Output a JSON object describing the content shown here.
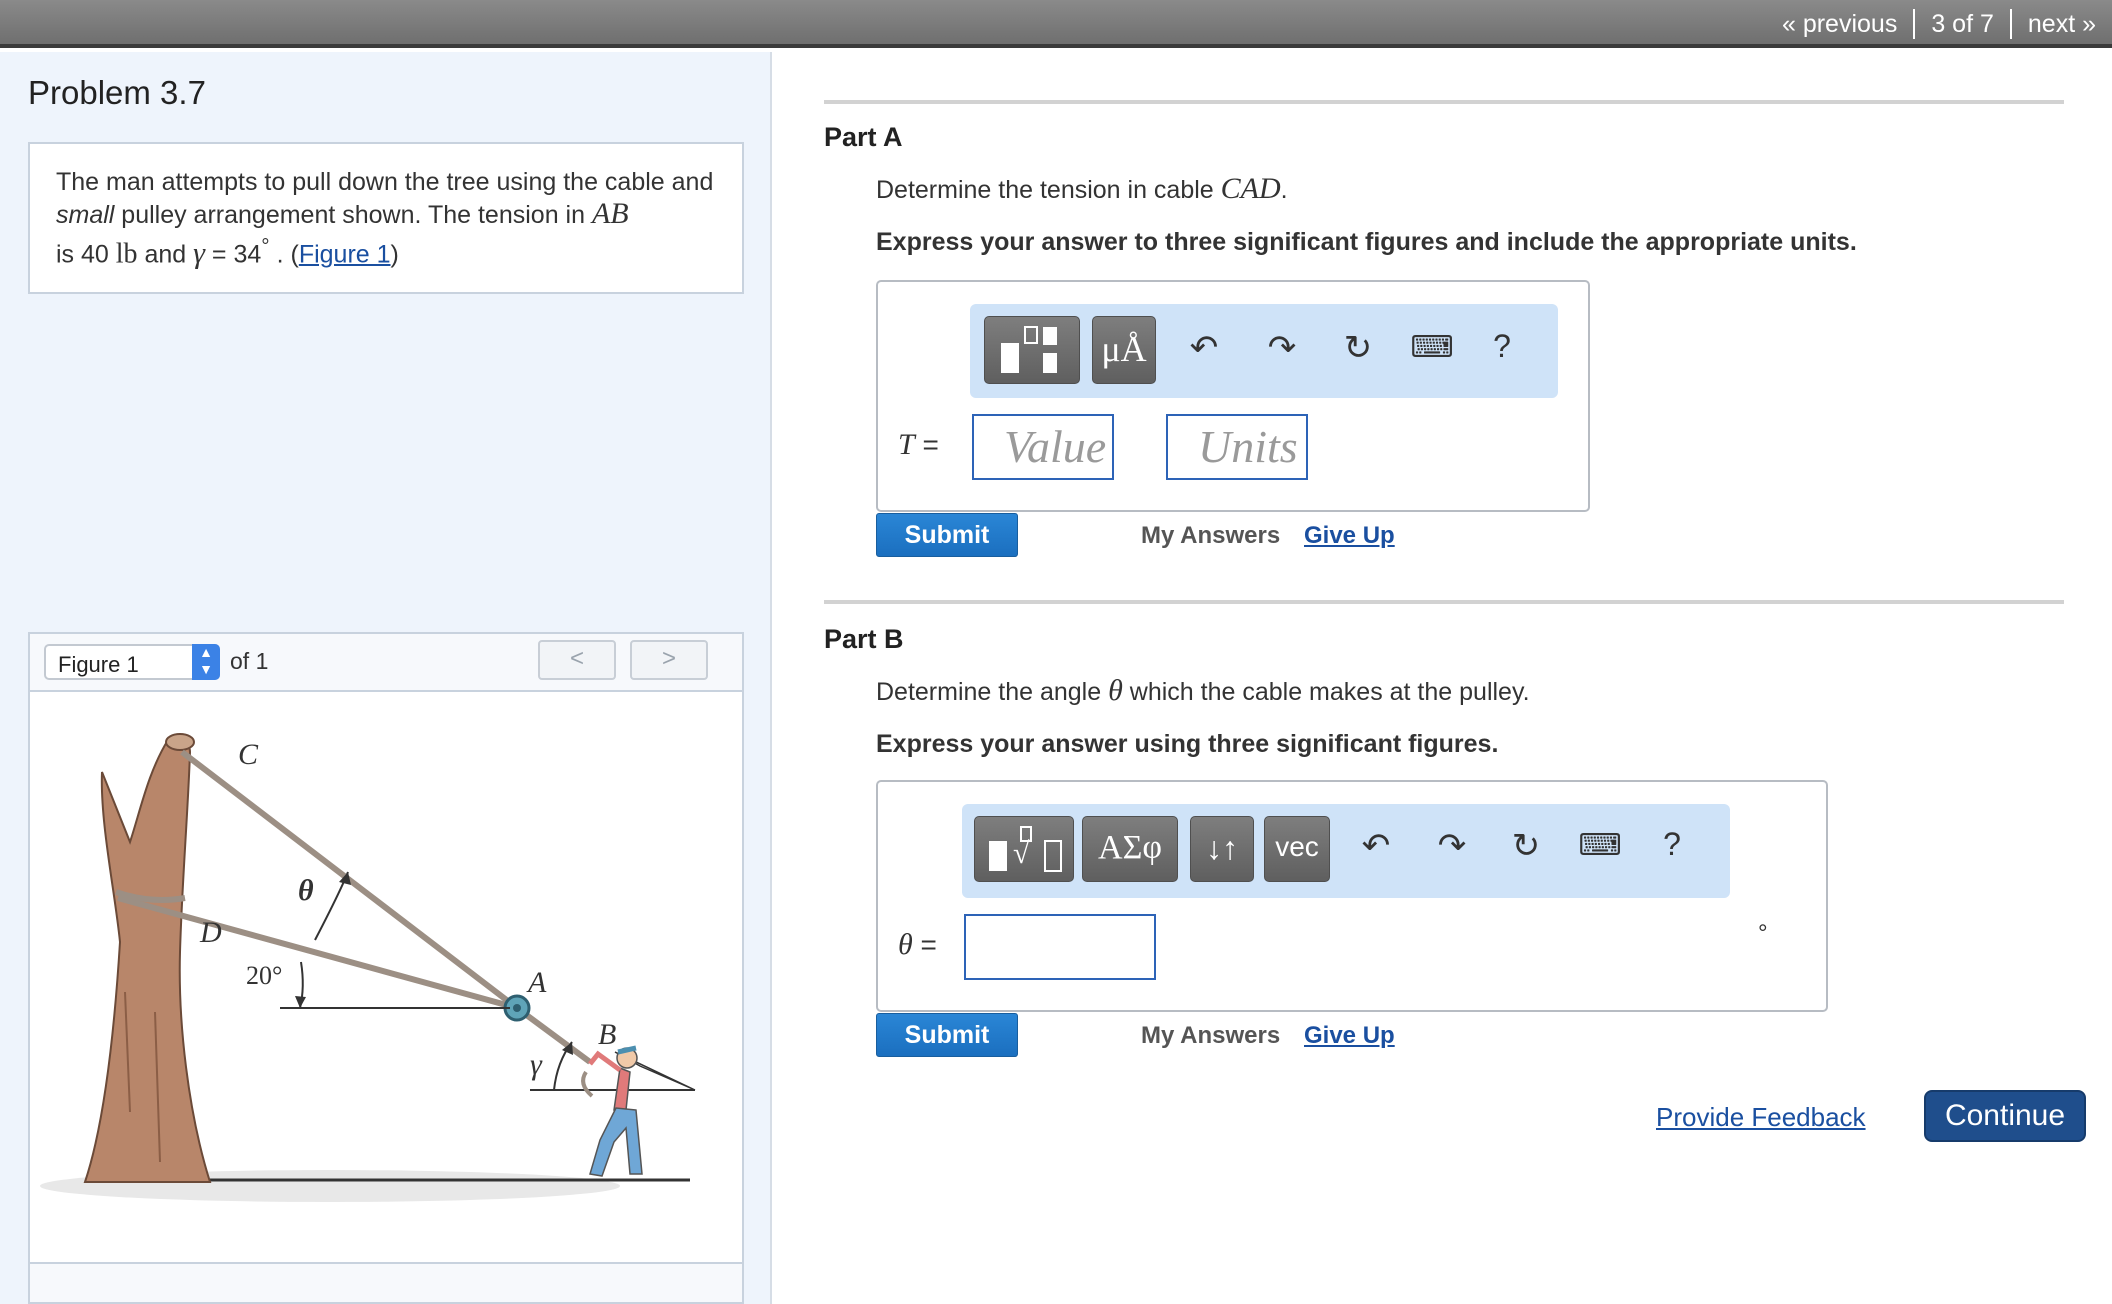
{
  "nav": {
    "previous": "« previous",
    "position": "3 of 7",
    "next": "next »"
  },
  "problem": {
    "title": "Problem 3.7",
    "text_1": "The man attempts to pull down the tree using the cable and ",
    "text_small": "small",
    "text_2": " pulley arrangement shown. The tension in ",
    "var_ab": "AB",
    "text_3": "is 40 ",
    "unit_lb": "lb",
    "text_4": " and ",
    "gamma_sym": "γ",
    "text_5": " = 34",
    "deg": "°",
    "text_6": " . (",
    "figure_link": "Figure 1",
    "text_7": ")"
  },
  "figure": {
    "select_value": "Figure 1",
    "of_text": "of 1",
    "prev": "<",
    "next": ">",
    "labels": {
      "C": "C",
      "D": "D",
      "A": "A",
      "B": "B",
      "theta": "θ",
      "gamma": "γ",
      "angle": "20°"
    }
  },
  "partA": {
    "title": "Part A",
    "question_pre": "Determine the tension in cable ",
    "question_var": "CAD",
    "question_post": ".",
    "instruction": "Express your answer to three significant figures and include the appropriate units.",
    "toolbar": {
      "units_btn": "μÅ",
      "help": "?"
    },
    "var_label": "T",
    "eq": " =",
    "value_placeholder": "Value",
    "units_placeholder": "Units",
    "submit": "Submit",
    "my_answers": "My Answers",
    "give_up": "Give Up"
  },
  "partB": {
    "title": "Part B",
    "question_pre": "Determine the angle ",
    "question_var": "θ",
    "question_post": " which the cable makes at the pulley.",
    "instruction": "Express your answer using three significant figures.",
    "toolbar": {
      "greek_btn": "ΑΣφ",
      "arrows_btn": "↓↑",
      "vec_btn": "vec",
      "help": "?"
    },
    "var_label": "θ",
    "eq": " =",
    "unit_suffix": "°",
    "submit": "Submit",
    "my_answers": "My Answers",
    "give_up": "Give Up"
  },
  "footer": {
    "feedback": "Provide Feedback",
    "continue": "Continue"
  }
}
